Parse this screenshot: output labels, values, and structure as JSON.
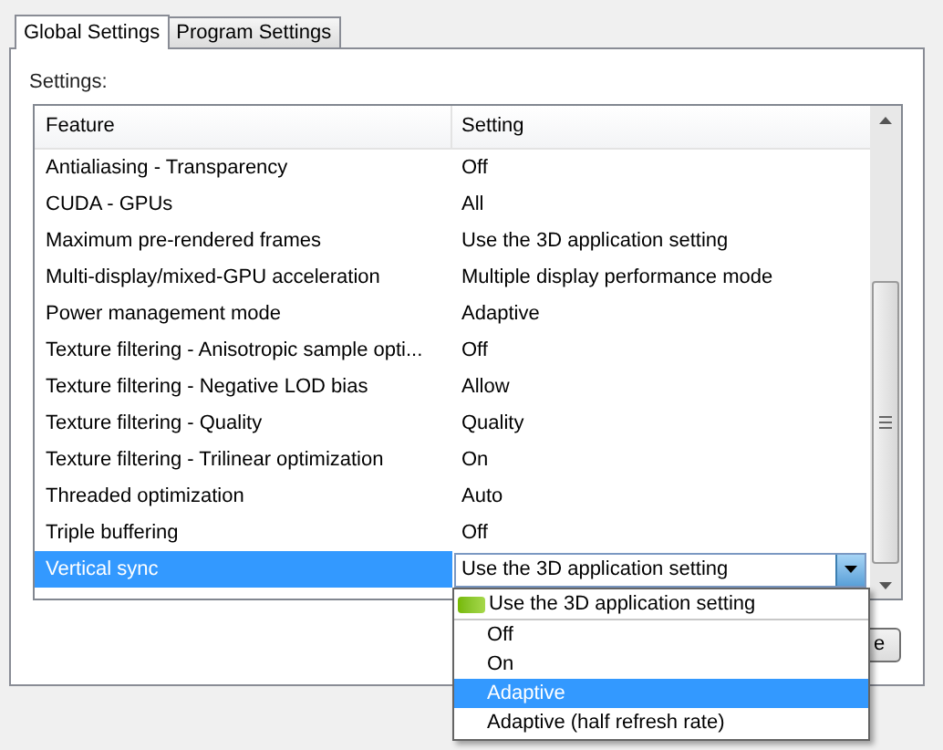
{
  "tabs": [
    {
      "label": "Global Settings",
      "selected": true
    },
    {
      "label": "Program Settings",
      "selected": false
    }
  ],
  "settings_label": "Settings:",
  "table": {
    "columns": [
      "Feature",
      "Setting"
    ],
    "rows": [
      {
        "feature": "Antialiasing - Transparency",
        "setting": "Off",
        "selected": false
      },
      {
        "feature": "CUDA - GPUs",
        "setting": "All",
        "selected": false
      },
      {
        "feature": "Maximum pre-rendered frames",
        "setting": "Use the 3D application setting",
        "selected": false
      },
      {
        "feature": "Multi-display/mixed-GPU acceleration",
        "setting": "Multiple display performance mode",
        "selected": false
      },
      {
        "feature": "Power management mode",
        "setting": "Adaptive",
        "selected": false
      },
      {
        "feature": "Texture filtering - Anisotropic sample opti...",
        "setting": "Off",
        "selected": false
      },
      {
        "feature": "Texture filtering - Negative LOD bias",
        "setting": "Allow",
        "selected": false
      },
      {
        "feature": "Texture filtering - Quality",
        "setting": "Quality",
        "selected": false
      },
      {
        "feature": "Texture filtering - Trilinear optimization",
        "setting": "On",
        "selected": false
      },
      {
        "feature": "Threaded optimization",
        "setting": "Auto",
        "selected": false
      },
      {
        "feature": "Triple buffering",
        "setting": "Off",
        "selected": false
      },
      {
        "feature": "Vertical sync",
        "setting": "Use the 3D application setting",
        "selected": true
      }
    ]
  },
  "dropdown": {
    "options": [
      {
        "label": "Use the 3D application setting",
        "selected": false
      },
      {
        "label": "Off",
        "selected": false
      },
      {
        "label": "On",
        "selected": false
      },
      {
        "label": "Adaptive",
        "selected": true
      },
      {
        "label": "Adaptive (half refresh rate)",
        "selected": false
      }
    ]
  },
  "button": {
    "label": "e"
  }
}
